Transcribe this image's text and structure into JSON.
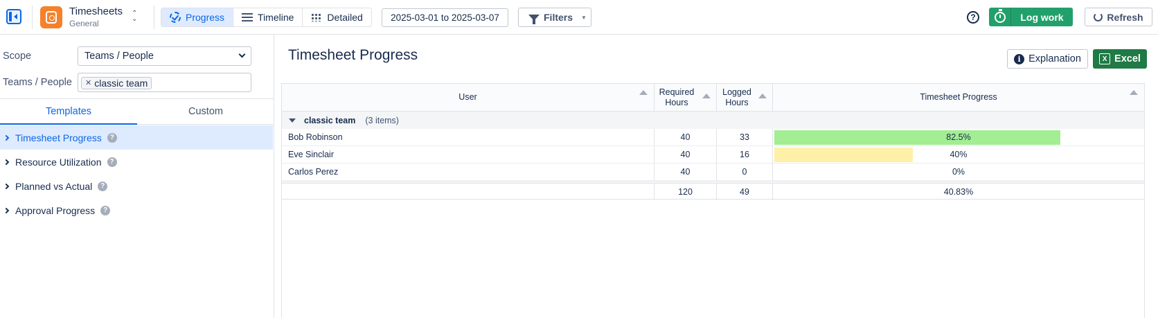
{
  "topbar": {
    "app_title": "Timesheets",
    "app_subtitle": "General",
    "views": [
      {
        "label": "Progress",
        "icon": "progress-check-icon",
        "active": true
      },
      {
        "label": "Timeline",
        "icon": "list-icon",
        "active": false
      },
      {
        "label": "Detailed",
        "icon": "grid-icon",
        "active": false
      }
    ],
    "date_range": "2025-03-01 to 2025-03-07",
    "filters_label": "Filters",
    "log_work_label": "Log work",
    "refresh_label": "Refresh",
    "colors": {
      "log_work": "#22a06b",
      "accent": "#0c66e4",
      "app_icon": "#f5812b"
    }
  },
  "sidebar": {
    "scope_label": "Scope",
    "scope_value": "Teams / People",
    "teams_label": "Teams / People",
    "teams_chips": [
      "classic team"
    ],
    "tabs": [
      {
        "label": "Templates",
        "active": true
      },
      {
        "label": "Custom",
        "active": false
      }
    ],
    "templates": [
      {
        "label": "Timesheet Progress",
        "selected": true
      },
      {
        "label": "Resource Utilization",
        "selected": false
      },
      {
        "label": "Planned vs Actual",
        "selected": false
      },
      {
        "label": "Approval Progress",
        "selected": false
      }
    ]
  },
  "main": {
    "title": "Timesheet Progress",
    "explanation_label": "Explanation",
    "excel_label": "Excel",
    "excel_color": "#1f7a45",
    "columns": {
      "user": "User",
      "required": "Required Hours",
      "logged": "Logged Hours",
      "progress": "Timesheet Progress"
    },
    "group": {
      "name": "classic team",
      "count": "(3 items)"
    },
    "rows": [
      {
        "user": "Bob Robinson",
        "required": "40",
        "logged": "33",
        "progress": "82.5%",
        "progress_value": 0.825,
        "bar_color": "#a3ed93"
      },
      {
        "user": "Eve Sinclair",
        "required": "40",
        "logged": "16",
        "progress": "40%",
        "progress_value": 0.4,
        "bar_color": "#fff0a8"
      },
      {
        "user": "Carlos Perez",
        "required": "40",
        "logged": "0",
        "progress": "0%",
        "progress_value": 0,
        "bar_color": "#fff0a8"
      }
    ],
    "totals": {
      "required": "120",
      "logged": "49",
      "progress": "40.83%"
    }
  }
}
